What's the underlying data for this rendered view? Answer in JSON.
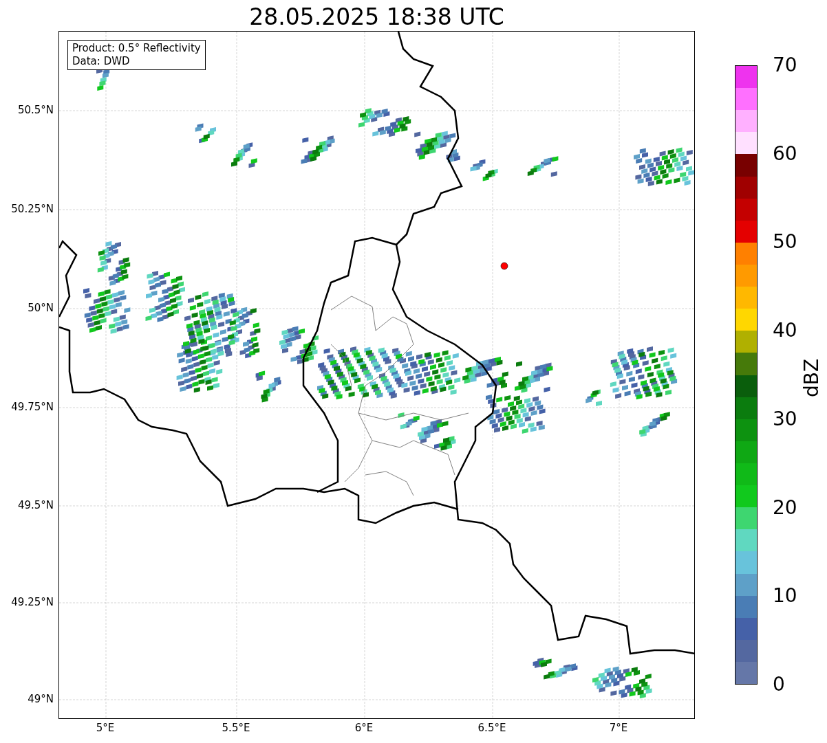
{
  "title": "28.05.2025 18:38 UTC",
  "info_box": [
    "Product: 0.5° Reflectivity",
    "Data: DWD"
  ],
  "map": {
    "lat_labels": [
      "50.5°N",
      "50.25°N",
      "50°N",
      "49.75°N",
      "49.5°N",
      "49.25°N",
      "49°N"
    ],
    "lon_labels": [
      "5°E",
      "5.5°E",
      "6°E",
      "6.5°E",
      "7°E"
    ]
  },
  "colorbar": {
    "label": "dBZ",
    "ticks": [
      "70",
      "60",
      "50",
      "40",
      "30",
      "20",
      "10",
      "0"
    ]
  }
}
